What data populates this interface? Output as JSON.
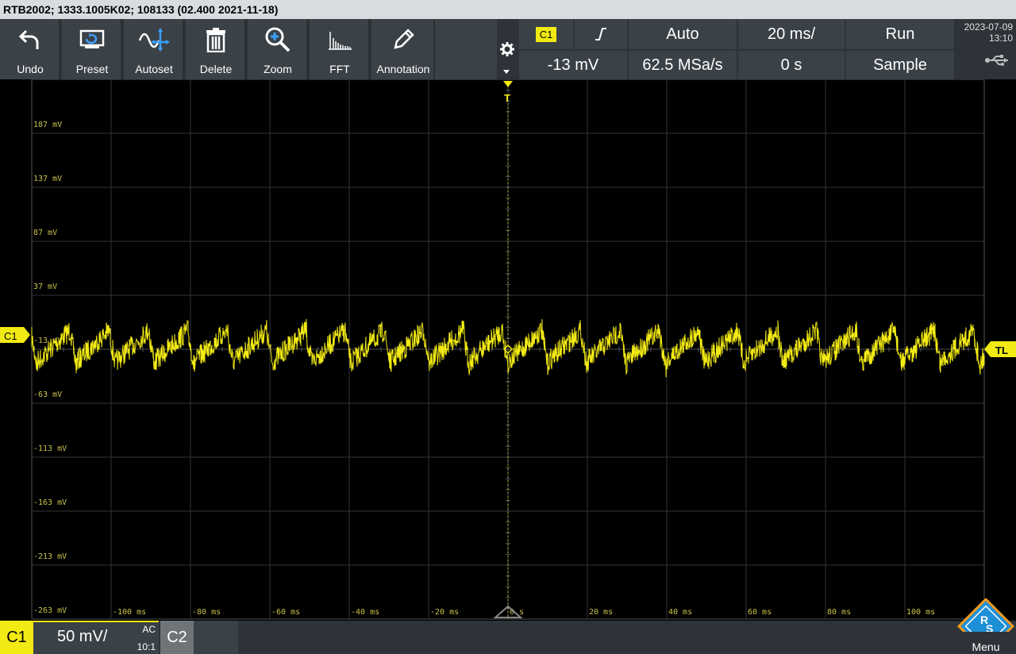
{
  "window": {
    "title": "RTB2002; 1333.1005K02; 108133 (02.400 2021-11-18)"
  },
  "toolbar": {
    "undo": "Undo",
    "preset": "Preset",
    "autoset": "Autoset",
    "delete": "Delete",
    "zoom": "Zoom",
    "fft": "FFT",
    "annotation": "Annotation"
  },
  "trigger": {
    "source": "C1",
    "level": "-13 mV",
    "mode": "Auto",
    "sample_rate": "62.5 MSa/s",
    "timebase": "20 ms/",
    "position": "0 s",
    "run_state": "Run",
    "acquisition": "Sample"
  },
  "status": {
    "date": "2023-07-09",
    "time": "13:10"
  },
  "scope": {
    "channel_label": "C1",
    "trigger_marker": "T",
    "trigger_level_marker": "TL",
    "y_labels": [
      "187 mV",
      "137 mV",
      "87 mV",
      "37 mV",
      "-13 mV",
      "-63 mV",
      "-113 mV",
      "-163 mV",
      "-213 mV",
      "-263 mV"
    ],
    "x_labels": [
      "-100 ms",
      "-80 ms",
      "-60 ms",
      "-40 ms",
      "-20 ms",
      "0 s",
      "20 ms",
      "40 ms",
      "60 ms",
      "80 ms",
      "100 ms"
    ],
    "trace_color": "#f2ea13",
    "grid_color": "#3a3a3a"
  },
  "bottom": {
    "c1": "C1",
    "c1_scale": "50 mV/",
    "c1_coupling": "AC",
    "c1_probe": "10:1",
    "c2": "C2",
    "menu": "Menu"
  },
  "colors": {
    "accent": "#f2ea13",
    "toolbar": "#3a4147",
    "logo": "#1e8fd6"
  }
}
